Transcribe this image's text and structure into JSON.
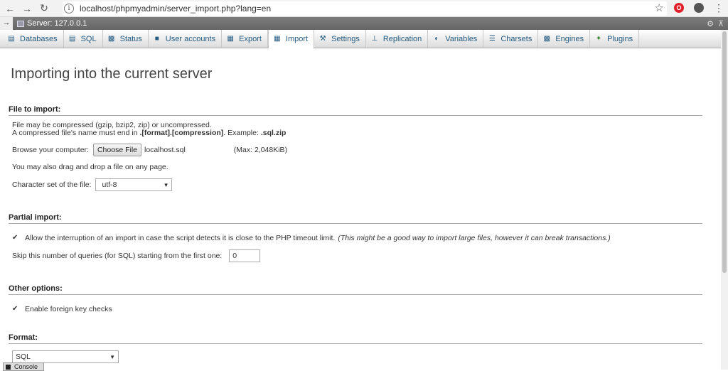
{
  "browser": {
    "url": "localhost/phpmyadmin/server_import.php?lang=en"
  },
  "serverbar": {
    "label": "Server: 127.0.0.1"
  },
  "tabs": [
    {
      "label": "Databases",
      "icon": "database-icon"
    },
    {
      "label": "SQL",
      "icon": "sql-icon"
    },
    {
      "label": "Status",
      "icon": "status-icon"
    },
    {
      "label": "User accounts",
      "icon": "user-accounts-icon"
    },
    {
      "label": "Export",
      "icon": "export-icon"
    },
    {
      "label": "Import",
      "icon": "import-icon",
      "active": true
    },
    {
      "label": "Settings",
      "icon": "wrench-icon"
    },
    {
      "label": "Replication",
      "icon": "replication-icon"
    },
    {
      "label": "Variables",
      "icon": "variables-icon"
    },
    {
      "label": "Charsets",
      "icon": "charsets-icon"
    },
    {
      "label": "Engines",
      "icon": "engines-icon"
    },
    {
      "label": "Plugins",
      "icon": "plugins-icon"
    }
  ],
  "page": {
    "title": "Importing into the current server"
  },
  "file_section": {
    "legend": "File to import:",
    "line1": "File may be compressed (gzip, bzip2, zip) or uncompressed.",
    "line2_a": "A compressed file's name must end in ",
    "line2_b": ".[format].[compression]",
    "line2_c": ". Example: ",
    "line2_d": ".sql.zip",
    "browse_label": "Browse your computer:",
    "choose_button": "Choose File",
    "filename": "localhost.sql",
    "max": "(Max: 2,048KiB)",
    "drag_text": "You may also drag and drop a file on any page.",
    "charset_label": "Character set of the file:",
    "charset_value": "utf-8"
  },
  "partial_section": {
    "legend": "Partial import:",
    "allow_text": "Allow the interruption of an import in case the script detects it is close to the PHP timeout limit.",
    "allow_note": "(This might be a good way to import large files, however it can break transactions.)",
    "allow_checked": true,
    "skip_label": "Skip this number of queries (for SQL) starting from the first one:",
    "skip_value": "0"
  },
  "other_section": {
    "legend": "Other options:",
    "fk_text": "Enable foreign key checks",
    "fk_checked": true
  },
  "format_section": {
    "legend": "Format:",
    "format_value": "SQL"
  },
  "console": {
    "label": "Console"
  },
  "colors": {
    "link": "#235a81",
    "serverbar": "#6e6e6e"
  }
}
